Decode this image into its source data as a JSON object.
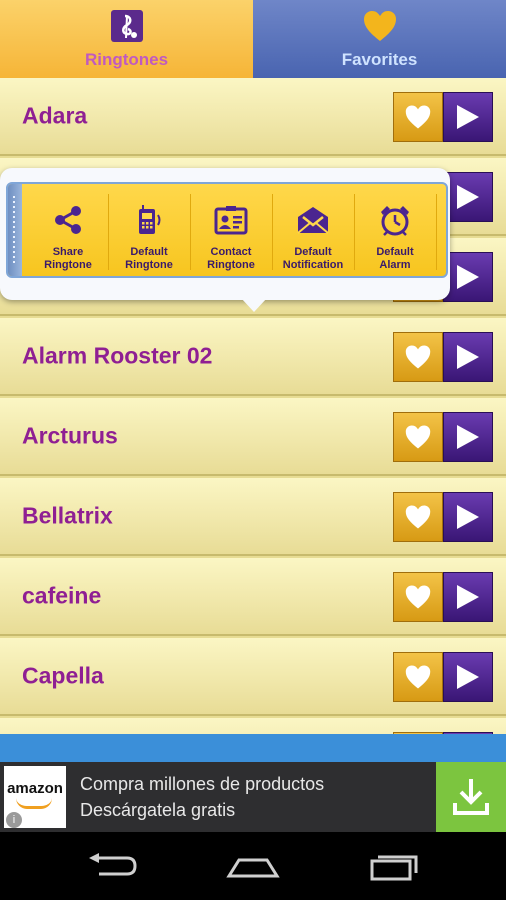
{
  "tabs": {
    "ringtones_label": "Ringtones",
    "favorites_label": "Favorites"
  },
  "list": {
    "rows": [
      {
        "title": "Adara"
      },
      {
        "title": ""
      },
      {
        "title": ""
      },
      {
        "title": "Alarm Rooster 02"
      },
      {
        "title": "Arcturus"
      },
      {
        "title": "Bellatrix"
      },
      {
        "title": "cafeine"
      },
      {
        "title": "Capella"
      }
    ]
  },
  "popup": {
    "actions": [
      {
        "label_line1": "Share",
        "label_line2": "Ringtone",
        "icon": "share-icon"
      },
      {
        "label_line1": "Default",
        "label_line2": "Ringtone",
        "icon": "phone-icon"
      },
      {
        "label_line1": "Contact",
        "label_line2": "Ringtone",
        "icon": "contact-card-icon"
      },
      {
        "label_line1": "Default",
        "label_line2": "Notification",
        "icon": "envelope-icon"
      },
      {
        "label_line1": "Default",
        "label_line2": "Alarm",
        "icon": "alarm-clock-icon"
      }
    ]
  },
  "ad": {
    "brand": "amazon",
    "line1": "Compra millones de productos",
    "line2": "Descárgatela gratis"
  },
  "colors": {
    "title_purple": "#8f1f93",
    "fav_gold": "#e2a91f",
    "play_purple": "#4a2390",
    "tab_yellow": "#f8c446",
    "tab_blue": "#5b74bf"
  }
}
